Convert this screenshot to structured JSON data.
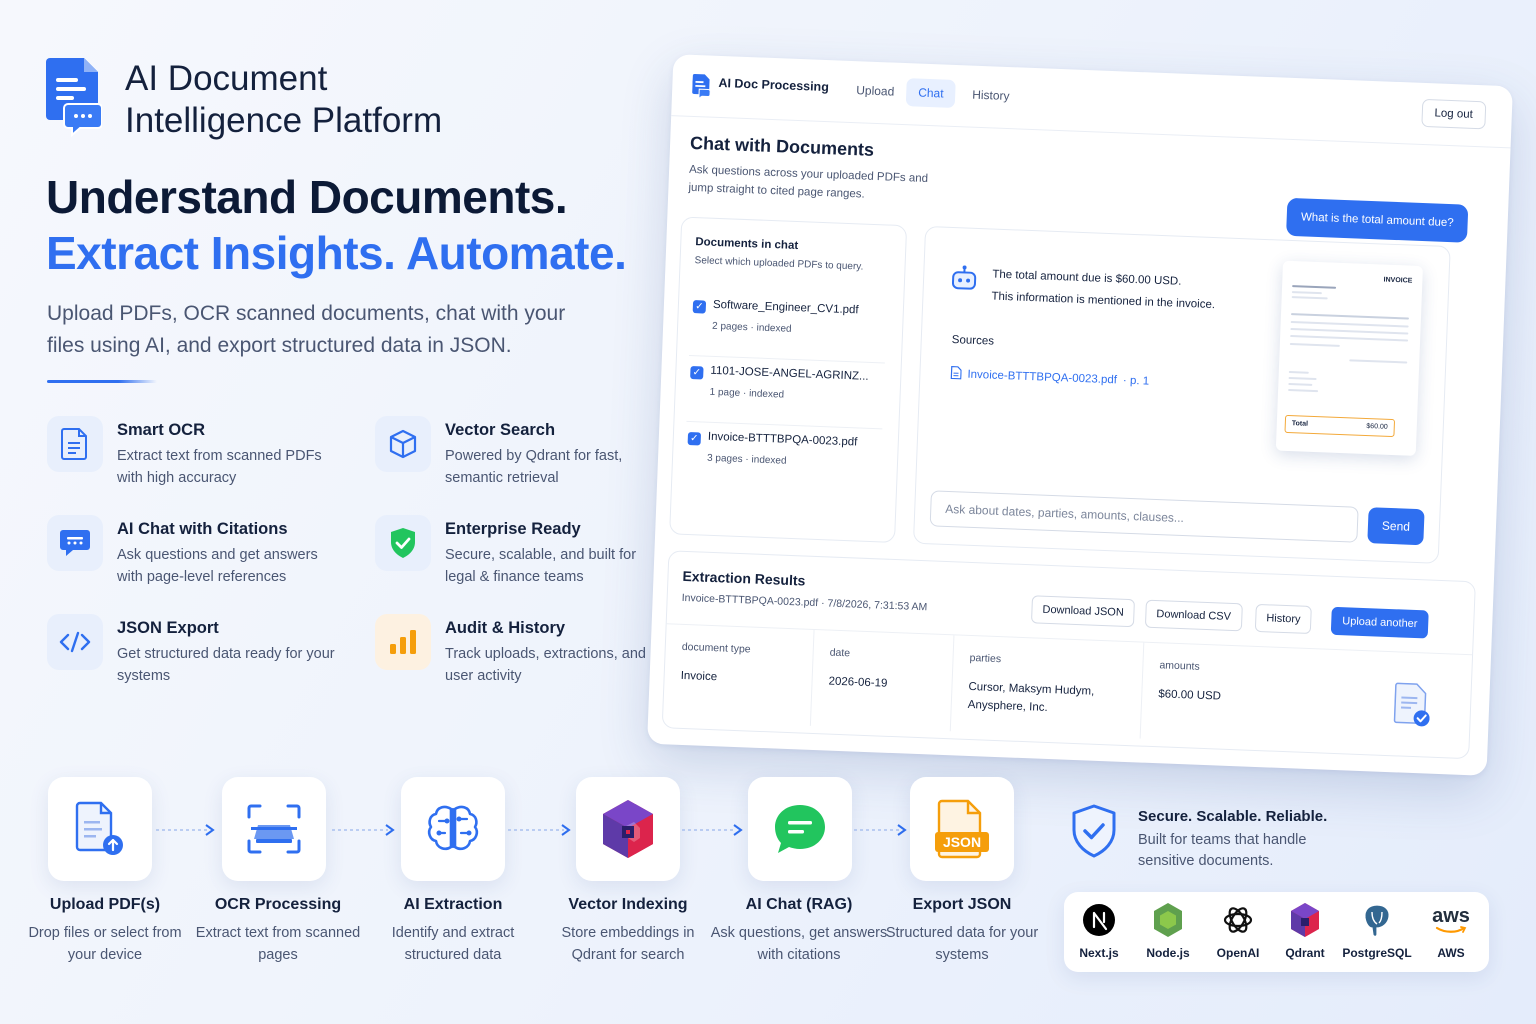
{
  "brand": {
    "title_line1": "AI Document",
    "title_line2": "Intelligence Platform"
  },
  "hero": {
    "headline1": "Understand Documents.",
    "headline2": "Extract Insights. Automate.",
    "subtitle": "Upload PDFs, OCR scanned documents, chat with your files using AI, and export structured data in JSON."
  },
  "features": [
    {
      "icon": "document-icon",
      "title": "Smart OCR",
      "desc": "Extract text from scanned PDFs with high accuracy"
    },
    {
      "icon": "cube-icon",
      "title": "Vector Search",
      "desc": "Powered by Qdrant for fast, semantic retrieval"
    },
    {
      "icon": "chat-icon",
      "title": "AI Chat with Citations",
      "desc": "Ask questions and get answers with page-level references"
    },
    {
      "icon": "shield-icon",
      "title": "Enterprise Ready",
      "desc": "Secure, scalable, and built for legal & finance teams"
    },
    {
      "icon": "code-icon",
      "title": "JSON Export",
      "desc": "Get structured data ready for your systems"
    },
    {
      "icon": "bar-chart-icon",
      "title": "Audit & History",
      "desc": "Track uploads, extractions, and user activity"
    }
  ],
  "app": {
    "name": "AI Doc Processing",
    "tabs": [
      "Upload",
      "Chat",
      "History"
    ],
    "active_tab": "Chat",
    "logout": "Log out",
    "chat": {
      "title": "Chat with Documents",
      "subtitle": "Ask questions across your uploaded PDFs and jump straight to cited page ranges.",
      "user_message": "What is the total amount due?",
      "docs_title": "Documents in chat",
      "docs_subtitle": "Select which uploaded PDFs to query.",
      "documents": [
        {
          "name": "Software_Engineer_CV1.pdf",
          "meta": "2 pages · indexed",
          "checked": true
        },
        {
          "name": "1101-JOSE-ANGEL-AGRINZ...",
          "meta": "1 page · indexed",
          "checked": true
        },
        {
          "name": "Invoice-BTTTBPQA-0023.pdf",
          "meta": "3 pages · indexed",
          "checked": true
        }
      ],
      "answer_line1": "The total amount due is $60.00 USD.",
      "answer_line2": "This information is mentioned in the invoice.",
      "sources_label": "Sources",
      "source_file": "Invoice-BTTTBPQA-0023.pdf",
      "source_page": "· p. 1",
      "invoice_header": "INVOICE",
      "invoice_total_label": "Total",
      "invoice_total_value": "$60.00",
      "input_placeholder": "Ask about dates, parties, amounts, clauses...",
      "send": "Send"
    },
    "extraction": {
      "title": "Extraction Results",
      "file": "Invoice-BTTTBPQA-0023.pdf",
      "timestamp": "7/8/2026, 7:31:53 AM",
      "buttons": [
        "Download JSON",
        "Download CSV",
        "History",
        "Upload another"
      ],
      "fields": [
        {
          "label": "document type",
          "value": "Invoice"
        },
        {
          "label": "date",
          "value": "2026-06-19"
        },
        {
          "label": "parties",
          "value": "Cursor, Maksym Hudym, Anysphere, Inc."
        },
        {
          "label": "amounts",
          "value": "$60.00 USD"
        }
      ]
    }
  },
  "pipeline": [
    {
      "icon": "upload-pdf-icon",
      "title": "Upload PDF(s)",
      "desc": "Drop files or select from your device"
    },
    {
      "icon": "scan-icon",
      "title": "OCR Processing",
      "desc": "Extract text from scanned pages"
    },
    {
      "icon": "brain-icon",
      "title": "AI Extraction",
      "desc": "Identify and extract structured data"
    },
    {
      "icon": "qdrant-icon",
      "title": "Vector Indexing",
      "desc": "Store embeddings in Qdrant for search"
    },
    {
      "icon": "chat-bubble-icon",
      "title": "AI Chat (RAG)",
      "desc": "Ask questions, get answers with citations"
    },
    {
      "icon": "json-file-icon",
      "title": "Export JSON",
      "desc": "Structured data for your systems"
    }
  ],
  "secure": {
    "title": "Secure. Scalable. Reliable.",
    "desc": "Built for teams that handle sensitive documents."
  },
  "tech_stack": [
    {
      "icon": "nextjs-logo",
      "name": "Next.js"
    },
    {
      "icon": "nodejs-logo",
      "name": "Node.js"
    },
    {
      "icon": "openai-logo",
      "name": "OpenAI"
    },
    {
      "icon": "qdrant-logo",
      "name": "Qdrant"
    },
    {
      "icon": "postgresql-logo",
      "name": "PostgreSQL"
    },
    {
      "icon": "aws-logo",
      "name": "AWS",
      "logo_text": "aws"
    }
  ],
  "colors": {
    "accent": "#2f6ff0",
    "heading": "#0c1a36",
    "body": "#4a5672",
    "success": "#22c55e",
    "warning": "#f59e0b",
    "qdrant": "#dc244c"
  }
}
